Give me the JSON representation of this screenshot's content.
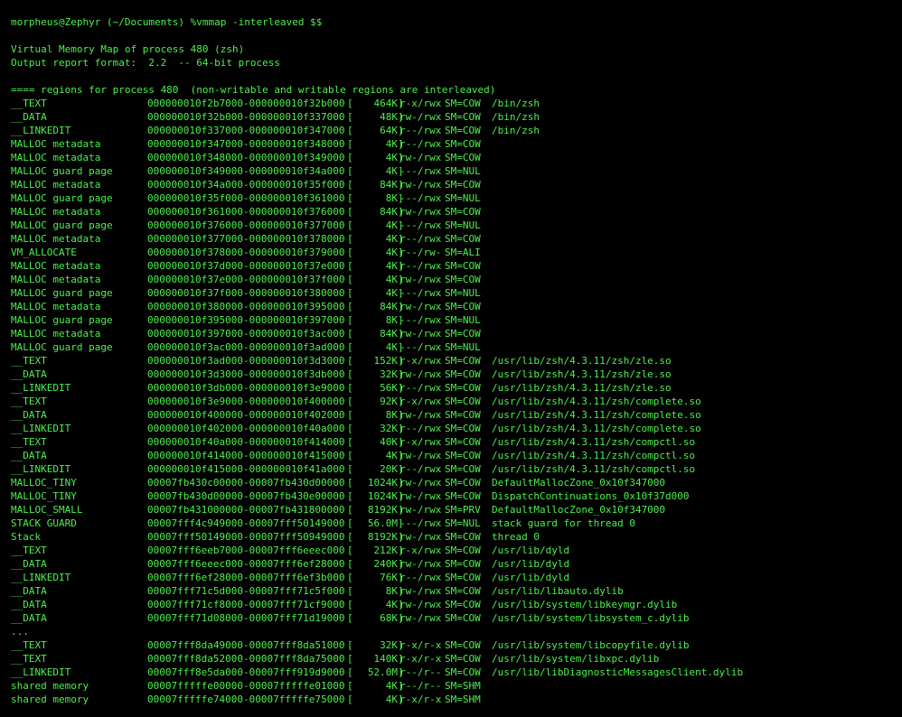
{
  "prompt": {
    "text": "morpheus@Zephyr (~/Documents) %vmmap -interleaved $$"
  },
  "header": {
    "title": "Virtual Memory Map of process 480 (zsh)",
    "format": "Output report format:  2.2  -- 64-bit process"
  },
  "section": {
    "title": "==== regions for process 480  (non-writable and writable regions are interleaved)"
  },
  "regions_a": [
    {
      "type": "__TEXT",
      "range": "000000010f2b7000-000000010f32b000",
      "size": "464K",
      "prot": "r-x/rwx",
      "sm": "SM=COW",
      "detail": "/bin/zsh"
    },
    {
      "type": "__DATA",
      "range": "000000010f32b000-000000010f337000",
      "size": "48K",
      "prot": "rw-/rwx",
      "sm": "SM=COW",
      "detail": "/bin/zsh"
    },
    {
      "type": "__LINKEDIT",
      "range": "000000010f337000-000000010f347000",
      "size": "64K",
      "prot": "r--/rwx",
      "sm": "SM=COW",
      "detail": "/bin/zsh"
    },
    {
      "type": "MALLOC metadata",
      "range": "000000010f347000-000000010f348000",
      "size": "4K",
      "prot": "r--/rwx",
      "sm": "SM=COW",
      "detail": ""
    },
    {
      "type": "MALLOC metadata",
      "range": "000000010f348000-000000010f349000",
      "size": "4K",
      "prot": "rw-/rwx",
      "sm": "SM=COW",
      "detail": ""
    },
    {
      "type": "MALLOC guard page",
      "range": "000000010f349000-000000010f34a000",
      "size": "4K",
      "prot": "---/rwx",
      "sm": "SM=NUL",
      "detail": ""
    },
    {
      "type": "MALLOC metadata",
      "range": "000000010f34a000-000000010f35f000",
      "size": "84K",
      "prot": "rw-/rwx",
      "sm": "SM=COW",
      "detail": ""
    },
    {
      "type": "MALLOC guard page",
      "range": "000000010f35f000-000000010f361000",
      "size": "8K",
      "prot": "---/rwx",
      "sm": "SM=NUL",
      "detail": ""
    },
    {
      "type": "MALLOC metadata",
      "range": "000000010f361000-000000010f376000",
      "size": "84K",
      "prot": "rw-/rwx",
      "sm": "SM=COW",
      "detail": ""
    },
    {
      "type": "MALLOC guard page",
      "range": "000000010f376000-000000010f377000",
      "size": "4K",
      "prot": "---/rwx",
      "sm": "SM=NUL",
      "detail": ""
    },
    {
      "type": "MALLOC metadata",
      "range": "000000010f377000-000000010f378000",
      "size": "4K",
      "prot": "r--/rwx",
      "sm": "SM=COW",
      "detail": ""
    },
    {
      "type": "VM_ALLOCATE",
      "range": "000000010f378000-000000010f379000",
      "size": "4K",
      "prot": "r--/rw-",
      "sm": "SM=ALI",
      "detail": ""
    },
    {
      "type": "MALLOC metadata",
      "range": "000000010f37d000-000000010f37e000",
      "size": "4K",
      "prot": "r--/rwx",
      "sm": "SM=COW",
      "detail": ""
    },
    {
      "type": "MALLOC metadata",
      "range": "000000010f37e000-000000010f37f000",
      "size": "4K",
      "prot": "rw-/rwx",
      "sm": "SM=COW",
      "detail": ""
    },
    {
      "type": "MALLOC guard page",
      "range": "000000010f37f000-000000010f380000",
      "size": "4K",
      "prot": "---/rwx",
      "sm": "SM=NUL",
      "detail": ""
    },
    {
      "type": "MALLOC metadata",
      "range": "000000010f380000-000000010f395000",
      "size": "84K",
      "prot": "rw-/rwx",
      "sm": "SM=COW",
      "detail": ""
    },
    {
      "type": "MALLOC guard page",
      "range": "000000010f395000-000000010f397000",
      "size": "8K",
      "prot": "---/rwx",
      "sm": "SM=NUL",
      "detail": ""
    },
    {
      "type": "MALLOC metadata",
      "range": "000000010f397000-000000010f3ac000",
      "size": "84K",
      "prot": "rw-/rwx",
      "sm": "SM=COW",
      "detail": ""
    },
    {
      "type": "MALLOC guard page",
      "range": "000000010f3ac000-000000010f3ad000",
      "size": "4K",
      "prot": "---/rwx",
      "sm": "SM=NUL",
      "detail": ""
    },
    {
      "type": "__TEXT",
      "range": "000000010f3ad000-000000010f3d3000",
      "size": "152K",
      "prot": "r-x/rwx",
      "sm": "SM=COW",
      "detail": "/usr/lib/zsh/4.3.11/zsh/zle.so"
    },
    {
      "type": "__DATA",
      "range": "000000010f3d3000-000000010f3db000",
      "size": "32K",
      "prot": "rw-/rwx",
      "sm": "SM=COW",
      "detail": "/usr/lib/zsh/4.3.11/zsh/zle.so"
    },
    {
      "type": "__LINKEDIT",
      "range": "000000010f3db000-000000010f3e9000",
      "size": "56K",
      "prot": "r--/rwx",
      "sm": "SM=COW",
      "detail": "/usr/lib/zsh/4.3.11/zsh/zle.so"
    },
    {
      "type": "__TEXT",
      "range": "000000010f3e9000-000000010f400000",
      "size": "92K",
      "prot": "r-x/rwx",
      "sm": "SM=COW",
      "detail": "/usr/lib/zsh/4.3.11/zsh/complete.so"
    },
    {
      "type": "__DATA",
      "range": "000000010f400000-000000010f402000",
      "size": "8K",
      "prot": "rw-/rwx",
      "sm": "SM=COW",
      "detail": "/usr/lib/zsh/4.3.11/zsh/complete.so"
    },
    {
      "type": "__LINKEDIT",
      "range": "000000010f402000-000000010f40a000",
      "size": "32K",
      "prot": "r--/rwx",
      "sm": "SM=COW",
      "detail": "/usr/lib/zsh/4.3.11/zsh/complete.so"
    },
    {
      "type": "__TEXT",
      "range": "000000010f40a000-000000010f414000",
      "size": "40K",
      "prot": "r-x/rwx",
      "sm": "SM=COW",
      "detail": "/usr/lib/zsh/4.3.11/zsh/compctl.so"
    },
    {
      "type": "__DATA",
      "range": "000000010f414000-000000010f415000",
      "size": "4K",
      "prot": "rw-/rwx",
      "sm": "SM=COW",
      "detail": "/usr/lib/zsh/4.3.11/zsh/compctl.so"
    },
    {
      "type": "__LINKEDIT",
      "range": "000000010f415000-000000010f41a000",
      "size": "20K",
      "prot": "r--/rwx",
      "sm": "SM=COW",
      "detail": "/usr/lib/zsh/4.3.11/zsh/compctl.so"
    },
    {
      "type": "MALLOC_TINY",
      "range": "00007fb430c00000-00007fb430d00000",
      "size": "1024K",
      "prot": "rw-/rwx",
      "sm": "SM=COW",
      "detail": "DefaultMallocZone_0x10f347000"
    },
    {
      "type": "MALLOC_TINY",
      "range": "00007fb430d00000-00007fb430e00000",
      "size": "1024K",
      "prot": "rw-/rwx",
      "sm": "SM=COW",
      "detail": "DispatchContinuations_0x10f37d000"
    },
    {
      "type": "MALLOC_SMALL",
      "range": "00007fb431000000-00007fb431800000",
      "size": "8192K",
      "prot": "rw-/rwx",
      "sm": "SM=PRV",
      "detail": "DefaultMallocZone_0x10f347000"
    },
    {
      "type": "STACK GUARD",
      "range": "00007fff4c949000-00007fff50149000",
      "size": "56.0M",
      "prot": "---/rwx",
      "sm": "SM=NUL",
      "detail": "stack guard for thread 0"
    },
    {
      "type": "Stack",
      "range": "00007fff50149000-00007fff50949000",
      "size": "8192K",
      "prot": "rw-/rwx",
      "sm": "SM=COW",
      "detail": "thread 0"
    },
    {
      "type": "__TEXT",
      "range": "00007fff6eeb7000-00007fff6eeec000",
      "size": "212K",
      "prot": "r-x/rwx",
      "sm": "SM=COW",
      "detail": "/usr/lib/dyld"
    },
    {
      "type": "__DATA",
      "range": "00007fff6eeec000-00007fff6ef28000",
      "size": "240K",
      "prot": "rw-/rwx",
      "sm": "SM=COW",
      "detail": "/usr/lib/dyld"
    },
    {
      "type": "__LINKEDIT",
      "range": "00007fff6ef28000-00007fff6ef3b000",
      "size": "76K",
      "prot": "r--/rwx",
      "sm": "SM=COW",
      "detail": "/usr/lib/dyld"
    },
    {
      "type": "__DATA",
      "range": "00007fff71c5d000-00007fff71c5f000",
      "size": "8K",
      "prot": "rw-/rwx",
      "sm": "SM=COW",
      "detail": "/usr/lib/libauto.dylib"
    },
    {
      "type": "__DATA",
      "range": "00007fff71cf8000-00007fff71cf9000",
      "size": "4K",
      "prot": "rw-/rwx",
      "sm": "SM=COW",
      "detail": "/usr/lib/system/libkeymgr.dylib"
    },
    {
      "type": "__DATA",
      "range": "00007fff71d08000-00007fff71d19000",
      "size": "68K",
      "prot": "rw-/rwx",
      "sm": "SM=COW",
      "detail": "/usr/lib/system/libsystem_c.dylib"
    }
  ],
  "ellipsis": {
    "text": "..."
  },
  "regions_b": [
    {
      "type": "__TEXT",
      "range": "00007fff8da49000-00007fff8da51000",
      "size": "32K",
      "prot": "r-x/r-x",
      "sm": "SM=COW",
      "detail": "/usr/lib/system/libcopyfile.dylib"
    },
    {
      "type": "__TEXT",
      "range": "00007fff8da52000-00007fff8da75000",
      "size": "140K",
      "prot": "r-x/r-x",
      "sm": "SM=COW",
      "detail": "/usr/lib/system/libxpc.dylib"
    },
    {
      "type": "__LINKEDIT",
      "range": "00007fff8e5da000-00007fff919d9000",
      "size": "52.0M",
      "prot": "r--/r--",
      "sm": "SM=COW",
      "detail": "/usr/lib/libDiagnosticMessagesClient.dylib"
    },
    {
      "type": "shared memory",
      "range": "00007fffffe00000-00007fffffe01000",
      "size": "4K",
      "prot": "r--/r--",
      "sm": "SM=SHM",
      "detail": ""
    },
    {
      "type": "shared memory",
      "range": "00007fffffe74000-00007fffffe75000",
      "size": "4K",
      "prot": "r-x/r-x",
      "sm": "SM=SHM",
      "detail": ""
    }
  ],
  "colors": {
    "background": "#000000",
    "text": "#4cf04c"
  }
}
